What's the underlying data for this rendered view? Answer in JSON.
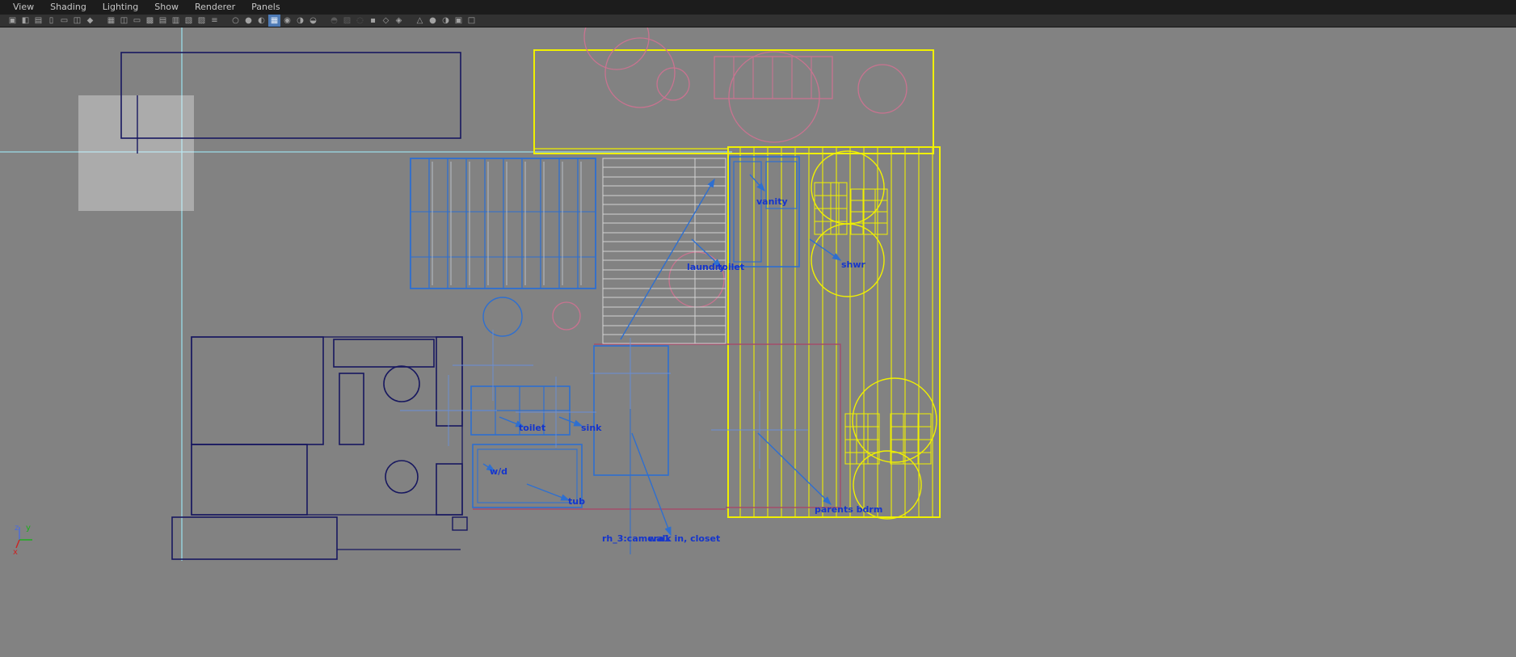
{
  "menu_bar": {
    "items": [
      {
        "name": "menu-view",
        "label": "View"
      },
      {
        "name": "menu-shading",
        "label": "Shading"
      },
      {
        "name": "menu-lighting",
        "label": "Lighting"
      },
      {
        "name": "menu-show",
        "label": "Show"
      },
      {
        "name": "menu-renderer",
        "label": "Renderer"
      },
      {
        "name": "menu-panels",
        "label": "Panels"
      }
    ]
  },
  "toolbar": {
    "icons": [
      {
        "name": "select-camera-icon",
        "glyph": "▣"
      },
      {
        "name": "lock-camera-icon",
        "glyph": "◧"
      },
      {
        "name": "camera-attributes-icon",
        "glyph": "▤"
      },
      {
        "name": "bookmark-icon",
        "glyph": "▯"
      },
      {
        "name": "image-plane-icon",
        "glyph": "▭"
      },
      {
        "name": "2d-pan-zoom-icon",
        "glyph": "◫"
      },
      {
        "name": "grease-pencil-icon",
        "glyph": "◆",
        "sep": true
      },
      {
        "name": "grid-icon",
        "glyph": "▦"
      },
      {
        "name": "film-gate-icon",
        "glyph": "◫"
      },
      {
        "name": "resolution-gate-icon",
        "glyph": "▭"
      },
      {
        "name": "gate-mask-icon",
        "glyph": "▩"
      },
      {
        "name": "field-chart-icon",
        "glyph": "▤"
      },
      {
        "name": "safe-action-icon",
        "glyph": "▥"
      },
      {
        "name": "safe-title-icon",
        "glyph": "▧"
      },
      {
        "name": "hud-icon",
        "glyph": "▨"
      },
      {
        "name": "object-details-icon",
        "glyph": "≡",
        "sep": true
      },
      {
        "name": "wireframe-icon",
        "glyph": "○"
      },
      {
        "name": "shaded-icon",
        "glyph": "●"
      },
      {
        "name": "wireframe-on-shaded-icon",
        "glyph": "◐"
      },
      {
        "name": "textured-icon",
        "glyph": "▦",
        "active": true
      },
      {
        "name": "use-all-lights-icon",
        "glyph": "◉"
      },
      {
        "name": "shadows-icon",
        "glyph": "◑"
      },
      {
        "name": "screen-space-ao-icon",
        "glyph": "◒",
        "sep": true
      },
      {
        "name": "motion-blur-icon",
        "glyph": "◓",
        "disabled": true
      },
      {
        "name": "multisample-aa-icon",
        "glyph": "▨",
        "disabled": true
      },
      {
        "name": "depth-of-field-icon",
        "glyph": "◌",
        "disabled": true
      },
      {
        "name": "isolate-select-icon",
        "glyph": "▪"
      },
      {
        "name": "xray-icon",
        "glyph": "◇"
      },
      {
        "name": "xray-active-components-icon",
        "glyph": "◈",
        "sep": true
      },
      {
        "name": "xray-joints-icon",
        "glyph": "△"
      },
      {
        "name": "exposure-icon",
        "glyph": "●"
      },
      {
        "name": "gamma-icon",
        "glyph": "◑"
      },
      {
        "name": "color-management-icon",
        "glyph": "▣"
      },
      {
        "name": "viewport-renderer-icon",
        "glyph": "□"
      }
    ]
  },
  "viewport": {
    "annotations": {
      "vanity": "vanity",
      "shwr": "shwr",
      "laundry": "laundry",
      "toilet_upper": "toilet",
      "toilet": "toilet",
      "sink": "sink",
      "washer_dryer": "w/d",
      "tub": "tub",
      "parents_bdrm": "parents bdrm",
      "camera": "rh_3:camera1",
      "walk_in_closet": "walk in, closet"
    },
    "axis": {
      "z": "z",
      "y": "y",
      "x": "x"
    },
    "colors": {
      "background": "#828282",
      "wireframe_navy": "#17175f",
      "selected_yellow": "#f0f000",
      "template_pink": "#c97390",
      "active_blue": "#2e6fd0",
      "grid_cyan": "#9adbe8",
      "label_blue": "#1535cc",
      "label_green": "#2d8a2d"
    }
  }
}
